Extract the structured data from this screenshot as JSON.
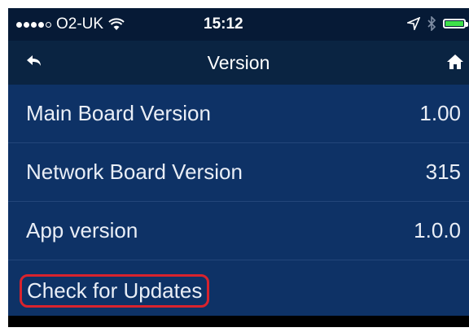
{
  "status_bar": {
    "carrier": "O2-UK",
    "time": "15:12",
    "battery_color": "#3ee04a"
  },
  "nav": {
    "title": "Version",
    "back_icon": "back-arrow-icon",
    "home_icon": "home-icon"
  },
  "rows": [
    {
      "label": "Main Board Version",
      "value": "1.00"
    },
    {
      "label": "Network Board Version",
      "value": "315"
    },
    {
      "label": "App version",
      "value": "1.0.0"
    }
  ],
  "action": {
    "label": "Check for Updates",
    "highlight_color": "#d9232d"
  },
  "colors": {
    "background": "#0e3266",
    "nav_background": "#0a2442",
    "status_background": "#061a36"
  }
}
